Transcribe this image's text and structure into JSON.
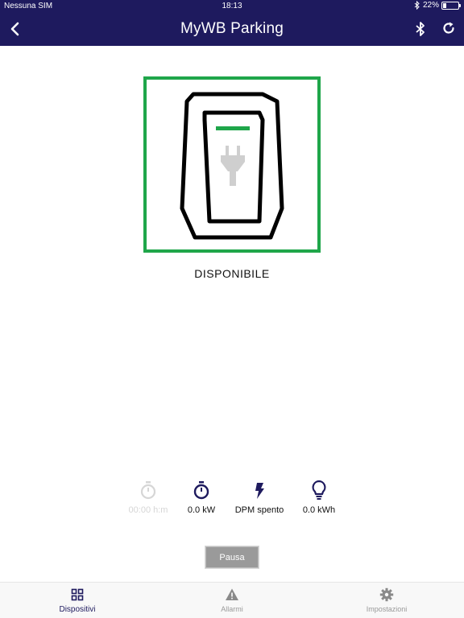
{
  "status_bar": {
    "carrier": "Nessuna SIM",
    "time": "18:13",
    "battery": "22%"
  },
  "header": {
    "title": "MyWB Parking"
  },
  "device": {
    "status": "DISPONIBILE",
    "frame_color": "#1fa64a"
  },
  "stats": [
    {
      "icon": "stopwatch-icon",
      "value": "00:00 h:m",
      "enabled": false
    },
    {
      "icon": "stopwatch-icon",
      "value": "0.0 kW",
      "enabled": true
    },
    {
      "icon": "lightning-icon",
      "value": "DPM spento",
      "enabled": true
    },
    {
      "icon": "lightbulb-icon",
      "value": "0.0 kWh",
      "enabled": true
    }
  ],
  "actions": {
    "pause_label": "Pausa"
  },
  "tabs": [
    {
      "label": "Dispositivi",
      "icon": "grid-icon",
      "active": true
    },
    {
      "label": "Allarmi",
      "icon": "warning-icon",
      "active": false
    },
    {
      "label": "Impostazioni",
      "icon": "gear-icon",
      "active": false
    }
  ],
  "colors": {
    "brand": "#1e1a5e",
    "available": "#1fa64a",
    "disabled": "#d6d6d6"
  }
}
